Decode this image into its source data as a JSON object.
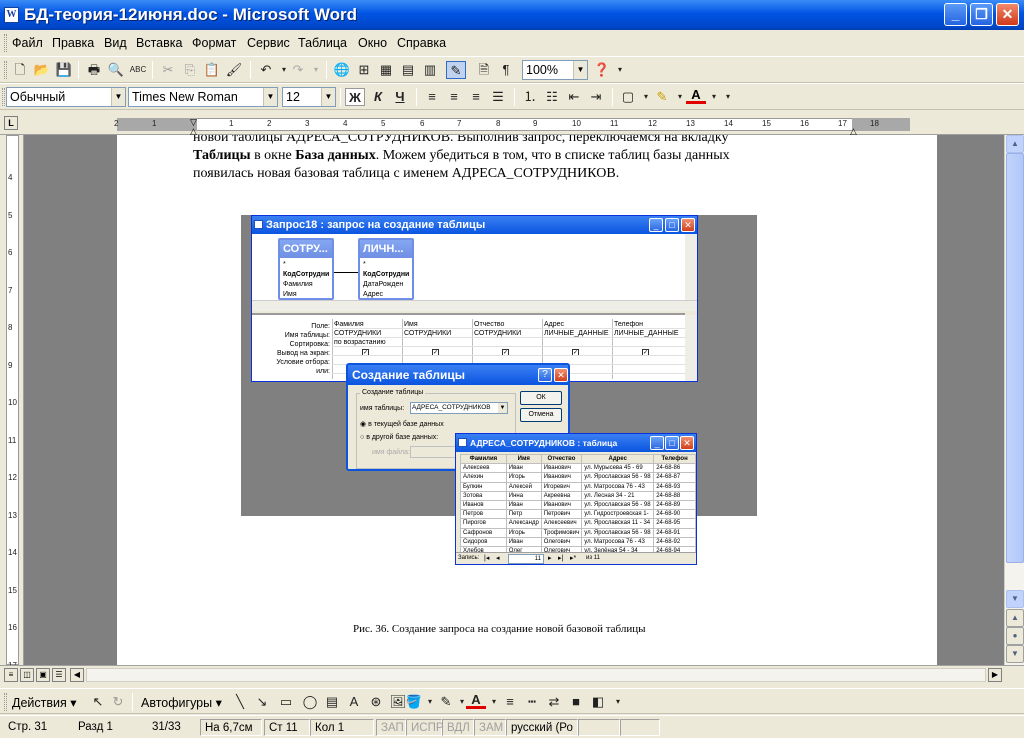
{
  "window": {
    "title": "БД-теория-12июня.doc - Microsoft Word",
    "icon": "W"
  },
  "menu": [
    "Файл",
    "Правка",
    "Вид",
    "Вставка",
    "Формат",
    "Сервис",
    "Таблица",
    "Окно",
    "Справка"
  ],
  "toolbar": {
    "zoom": "100%"
  },
  "formatting": {
    "style": "Обычный",
    "font": "Times New Roman",
    "size": "12",
    "bold": "Ж",
    "italic": "К",
    "underline": "Ч"
  },
  "ruler": {
    "h_ticks": [
      "2",
      "1",
      "1",
      "2",
      "3",
      "4",
      "5",
      "6",
      "7",
      "8",
      "9",
      "10",
      "11",
      "12",
      "13",
      "14",
      "15",
      "16",
      "17",
      "18"
    ],
    "v_ticks": [
      "4",
      "5",
      "6",
      "7",
      "8",
      "9",
      "10",
      "11",
      "12",
      "13",
      "14",
      "15",
      "16",
      "17"
    ]
  },
  "document": {
    "line1": "новой таблицы АДРЕСА_СОТРУДНИКОВ. Выполнив запрос, переключаемся на вкладку",
    "line2_b1": "Таблицы",
    "line2_t1": " в окне ",
    "line2_b2": "База данных",
    "line2_t2": ". Можем убедиться в том, что в списке таблиц базы данных",
    "line3": "появилась новая базовая таблица с именем АДРЕСА_СОТРУДНИКОВ.",
    "caption": "Рис. 36. Создание запроса на создание новой  базовой таблицы"
  },
  "query_window": {
    "title": "Запрос18 : запрос на создание таблицы",
    "tables": [
      {
        "name": "СОТРУ...",
        "fields": [
          "*",
          "КодСотрудни",
          "Фамилия",
          "Имя"
        ]
      },
      {
        "name": "ЛИЧН...",
        "fields": [
          "*",
          "КодСотрудни",
          "ДатаРожден",
          "Адрес"
        ]
      }
    ],
    "grid_labels": [
      "Поле:",
      "Имя таблицы:",
      "Сортировка:",
      "Вывод на экран:",
      "Условие отбора:",
      "или:"
    ],
    "columns": [
      {
        "field": "Фамилия",
        "table": "СОТРУДНИКИ",
        "sort": "по возрастанию",
        "show": "✓"
      },
      {
        "field": "Имя",
        "table": "СОТРУДНИКИ",
        "sort": "",
        "show": "✓"
      },
      {
        "field": "Отчество",
        "table": "СОТРУДНИКИ",
        "sort": "",
        "show": "✓"
      },
      {
        "field": "Адрес",
        "table": "ЛИЧНЫЕ_ДАННЫЕ",
        "sort": "",
        "show": "✓"
      },
      {
        "field": "Телефон",
        "table": "ЛИЧНЫЕ_ДАННЫЕ",
        "sort": "",
        "show": "✓"
      }
    ]
  },
  "create_dialog": {
    "title": "Создание таблицы",
    "group": "Создание таблицы",
    "name_label": "имя таблицы:",
    "name_value": "АДРЕСА_СОТРУДНИКОВ",
    "radio1": "в текущей базе данных",
    "radio2": "в другой базе данных:",
    "file_label": "имя файла:",
    "ok": "ОК",
    "cancel": "Отмена",
    "help": "?"
  },
  "result_table": {
    "title": "АДРЕСА_СОТРУДНИКОВ : таблица",
    "headers": [
      "Фамилия",
      "Имя",
      "Отчество",
      "Адрес",
      "Телефон"
    ],
    "rows": [
      [
        "Алексеев",
        "Иван",
        "Иванович",
        "ул. Мурысева 45 - 69",
        "24-68-86"
      ],
      [
        "Алехин",
        "Игорь",
        "Иванович",
        "ул. Ярославская 56 - 98",
        "24-68-87"
      ],
      [
        "Булкин",
        "Алексей",
        "Игоревич",
        "ул. Матросова 76 - 43",
        "24-68-93"
      ],
      [
        "Зотова",
        "Инна",
        "Акреевна",
        "ул. Лесная 34 - 21",
        "24-68-88"
      ],
      [
        "Иванов",
        "Иван",
        "Иванович",
        "ул. Ярославская 56 - 98",
        "24-68-89"
      ],
      [
        "Петров",
        "Петр",
        "Петрович",
        "ул. Гидростроевская 1-",
        "24-68-90"
      ],
      [
        "Пирогов",
        "Александр",
        "Алексеевич",
        "ул. Ярославская 11 - 34",
        "24-68-95"
      ],
      [
        "Сафронов",
        "Игорь",
        "Трофимович",
        "ул. Ярославская 56 - 98",
        "24-68-91"
      ],
      [
        "Сидоров",
        "Иван",
        "Олегович",
        "ул. Матросова 76 - 43",
        "24-68-92"
      ],
      [
        "Хлебов",
        "Олег",
        "Олегович",
        "ул. Зелёная 54 - 34",
        "24-68-94"
      ]
    ],
    "nav": {
      "label": "Запись:",
      "current": "11",
      "total": "из 11"
    }
  },
  "drawing": {
    "actions": "Действия ▾",
    "autoshapes": "Автофигуры ▾"
  },
  "status": {
    "page": "Стр.  31",
    "section": "Разд  1",
    "pages": "31/33",
    "at": "На 6,7см",
    "line": "Ст  11",
    "col": "Кол  1",
    "rec": "ЗАП",
    "trk": "ИСПР",
    "ext": "ВДЛ",
    "ovr": "ЗАМ",
    "lang": "русский (Ро"
  }
}
